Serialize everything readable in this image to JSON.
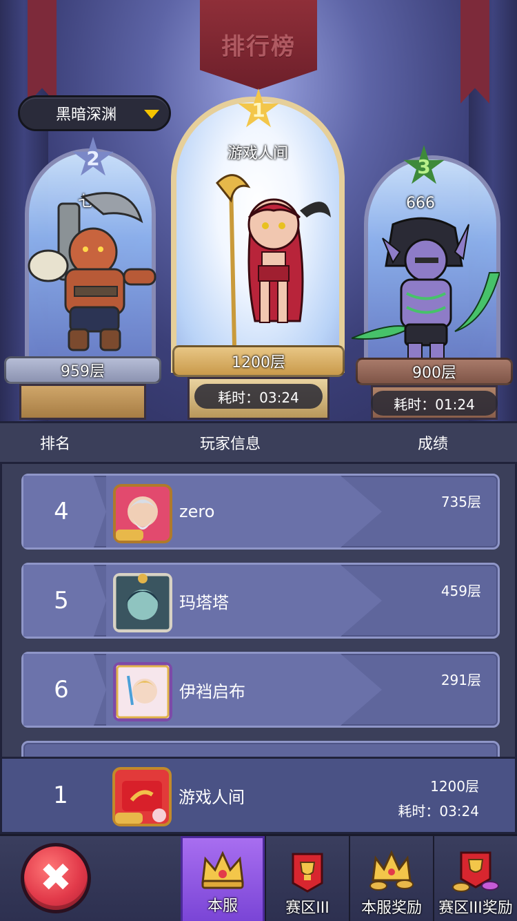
{
  "title": "排行榜",
  "dropdown": {
    "selected": "黑暗深渊"
  },
  "podium": {
    "first": {
      "rank": "1",
      "name": "游戏人间",
      "floor": "1200层",
      "time": "耗时：03:24"
    },
    "second": {
      "rank": "2",
      "name": "七星",
      "floor": "959层"
    },
    "third": {
      "rank": "3",
      "name": "666",
      "floor": "900层",
      "time": "耗时：01:24"
    }
  },
  "columns": {
    "rank": "排名",
    "player": "玩家信息",
    "score": "成绩"
  },
  "rows": [
    {
      "rank": "4",
      "name": "zero",
      "score": "735层"
    },
    {
      "rank": "5",
      "name": "玛塔塔",
      "score": "459层"
    },
    {
      "rank": "6",
      "name": "伊裆启布",
      "score": "291层"
    }
  ],
  "self": {
    "rank": "1",
    "name": "游戏人间",
    "score": "1200层",
    "time": "耗时：03:24"
  },
  "tabs": [
    {
      "label": "本服",
      "icon": "crown-icon"
    },
    {
      "label": "赛区III",
      "icon": "trophy-banner-icon"
    },
    {
      "label": "本服奖励",
      "icon": "crown-coins-icon"
    },
    {
      "label": "赛区III奖励",
      "icon": "trophy-coins-icon"
    }
  ],
  "close_icon": "close-icon",
  "colors": {
    "accent": "#9a63ec",
    "close": "#e23a4a",
    "gold": "#f3c64a",
    "row": "#5f669c"
  }
}
